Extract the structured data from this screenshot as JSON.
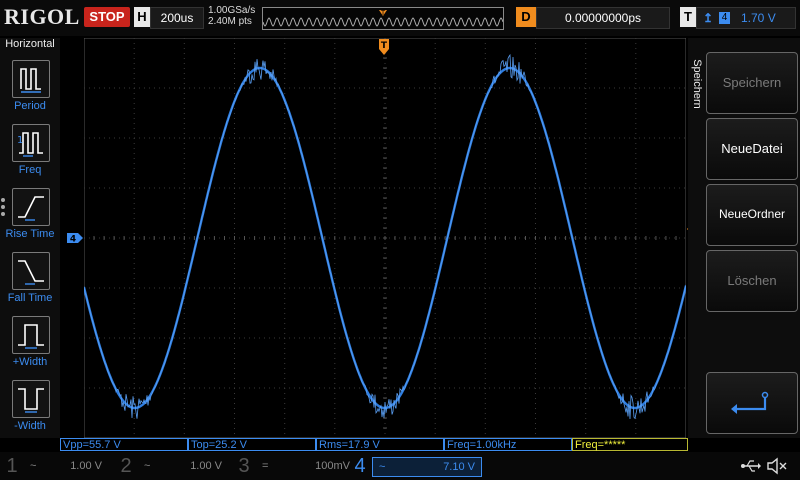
{
  "header": {
    "logo": "RIGOL",
    "run_state": "STOP",
    "timebase_badge": "H",
    "timebase_value": "200us",
    "sample_rate": "1.00GSa/s",
    "memory_depth": "2.40M pts",
    "trigger_marker": "T",
    "delay_badge": "D",
    "delay_value": "0.00000000ps",
    "trigger_badge": "T",
    "trigger_source": "4",
    "trigger_level": "1.70 V"
  },
  "left_menu": {
    "title": "Horizontal",
    "items": [
      {
        "label": "Period",
        "icon": "period-icon"
      },
      {
        "label": "Freq",
        "icon": "frequency-icon"
      },
      {
        "label": "Rise Time",
        "icon": "rise-time-icon"
      },
      {
        "label": "Fall Time",
        "icon": "fall-time-icon"
      },
      {
        "label": "+Width",
        "icon": "positive-width-icon"
      },
      {
        "label": "-Width",
        "icon": "negative-width-icon"
      }
    ]
  },
  "right_menu": {
    "title": "Speichern",
    "buttons": [
      {
        "label": "Speichern",
        "enabled": false
      },
      {
        "label": "NeueDatei",
        "enabled": true
      },
      {
        "label": "NeueOrdner",
        "enabled": true
      },
      {
        "label": "Löschen",
        "enabled": false
      }
    ],
    "enter_icon": "enter-icon"
  },
  "markers": {
    "trigger_position": "T",
    "channel_offset": "4"
  },
  "measurements": [
    {
      "label": "Vpp=55.7 V",
      "color": "blue"
    },
    {
      "label": "Top=25.2 V",
      "color": "blue"
    },
    {
      "label": "Rms=17.9 V",
      "color": "blue"
    },
    {
      "label": "Freq=1.00kHz",
      "color": "blue"
    },
    {
      "label": "Freq=*****",
      "color": "yellow"
    }
  ],
  "channels": [
    {
      "number": "1",
      "coupling": "~",
      "scale": "1.00 V",
      "active": false
    },
    {
      "number": "2",
      "coupling": "~",
      "scale": "1.00 V",
      "active": false
    },
    {
      "number": "3",
      "coupling": "=",
      "scale": "100mV",
      "active": false
    },
    {
      "number": "4",
      "coupling": "~",
      "scale": "7.10 V",
      "active": true
    }
  ],
  "colors": {
    "channel4": "#3c8cf0",
    "stop": "#c8241c",
    "delay": "#f08c1e",
    "measurement_yellow": "#f0f03c",
    "background": "#000000"
  }
}
